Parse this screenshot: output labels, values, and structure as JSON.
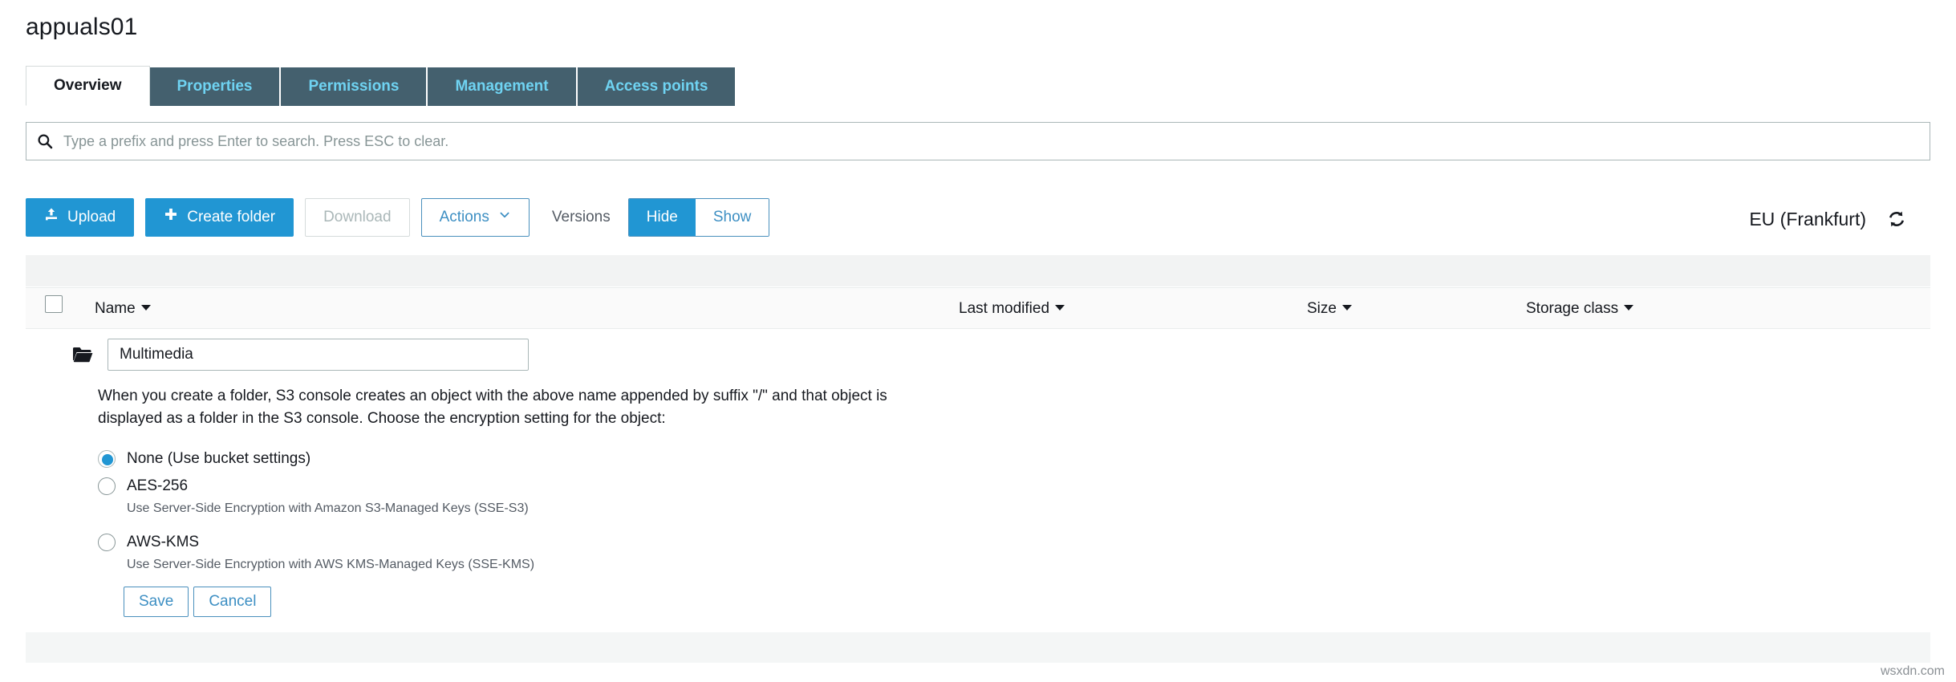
{
  "page": {
    "title": "appuals01",
    "watermark": "wsxdn.com"
  },
  "tabs": [
    {
      "label": "Overview",
      "active": true
    },
    {
      "label": "Properties",
      "active": false
    },
    {
      "label": "Permissions",
      "active": false
    },
    {
      "label": "Management",
      "active": false
    },
    {
      "label": "Access points",
      "active": false
    }
  ],
  "search": {
    "icon": "search-icon",
    "value": "",
    "placeholder": "Type a prefix and press Enter to search. Press ESC to clear."
  },
  "toolbar": {
    "upload_label": "Upload",
    "upload_icon": "upload-icon",
    "create_folder_label": "Create folder",
    "create_folder_icon": "plus-icon",
    "download_label": "Download",
    "actions_label": "Actions",
    "actions_icon": "chevron-down-icon",
    "versions_label": "Versions",
    "versions_hide_label": "Hide",
    "versions_show_label": "Show",
    "versions_selected": "Hide",
    "region_label": "EU (Frankfurt)",
    "refresh_icon": "refresh-icon"
  },
  "table": {
    "columns": [
      {
        "label": "Name",
        "sortable": true
      },
      {
        "label": "Last modified",
        "sortable": true
      },
      {
        "label": "Size",
        "sortable": true
      },
      {
        "label": "Storage class",
        "sortable": true
      }
    ],
    "select_all_checked": false,
    "rows": []
  },
  "create_folder_form": {
    "folder_icon": "folder-icon",
    "folder_name_value": "Multimedia",
    "folder_name_placeholder": "",
    "help_text": "When you create a folder, S3 console creates an object with the above name appended by suffix \"/\" and that object is displayed as a folder in the S3 console. Choose the encryption setting for the object:",
    "encryption_options": [
      {
        "label": "None (Use bucket settings)",
        "description": "",
        "selected": true
      },
      {
        "label": "AES-256",
        "description": "Use Server-Side Encryption with Amazon S3-Managed Keys (SSE-S3)",
        "selected": false
      },
      {
        "label": "AWS-KMS",
        "description": "Use Server-Side Encryption with AWS KMS-Managed Keys (SSE-KMS)",
        "selected": false
      }
    ],
    "save_label": "Save",
    "cancel_label": "Cancel"
  },
  "colors": {
    "accent_blue": "#2196d3",
    "tab_inactive_bg": "#44606e",
    "tab_inactive_text": "#6fd3f2",
    "link_blue": "#3d8fc3",
    "text_dark": "#16191f",
    "muted_text": "#545b64",
    "border": "#aab7b8"
  }
}
